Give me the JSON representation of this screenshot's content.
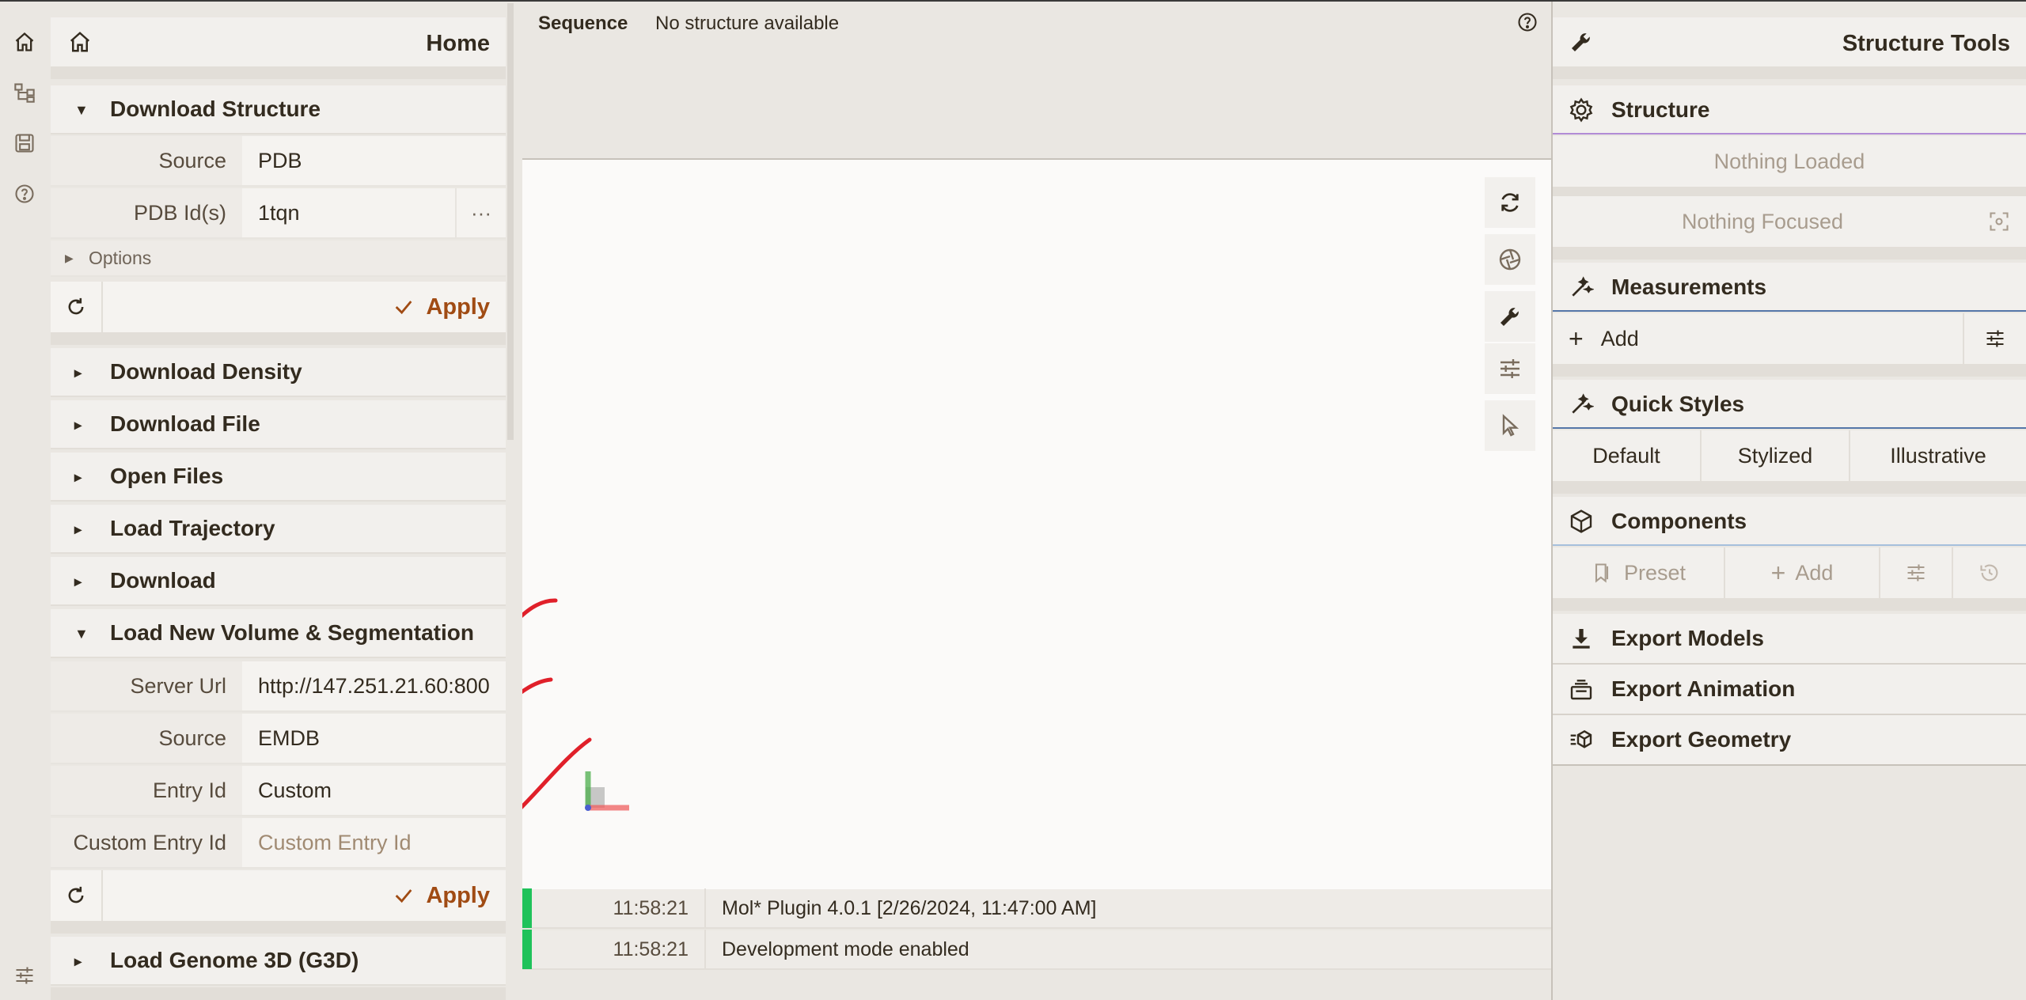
{
  "left_strip": {
    "icons": [
      "home-icon",
      "tree-icon",
      "save-icon",
      "help-icon",
      "settings-sliders-icon"
    ]
  },
  "left_panel": {
    "title": "Home",
    "download_structure": {
      "label": "Download Structure",
      "source_label": "Source",
      "source_value": "PDB",
      "pdb_label": "PDB Id(s)",
      "pdb_value": "1tqn",
      "more": "···",
      "options_label": "Options",
      "apply_label": "Apply"
    },
    "sections": [
      {
        "label": "Download Density"
      },
      {
        "label": "Download File"
      },
      {
        "label": "Open Files"
      },
      {
        "label": "Load Trajectory"
      },
      {
        "label": "Download"
      }
    ],
    "volume_seg": {
      "label": "Load New Volume & Segmentation",
      "server_label": "Server Url",
      "server_value": "http://147.251.21.60:800",
      "source_label": "Source",
      "source_value": "EMDB",
      "entry_label": "Entry Id",
      "entry_value": "Custom",
      "custom_label": "Custom Entry Id",
      "custom_placeholder": "Custom Entry Id",
      "apply_label": "Apply"
    },
    "genome": {
      "label": "Load Genome 3D (G3D)"
    }
  },
  "sequence": {
    "label": "Sequence",
    "status": "No structure available"
  },
  "log": [
    {
      "time": "11:58:21",
      "message": "Mol* Plugin 4.0.1 [2/26/2024, 11:47:00 AM]"
    },
    {
      "time": "11:58:21",
      "message": "Development mode enabled"
    }
  ],
  "right_panel": {
    "title": "Structure Tools",
    "structure": {
      "label": "Structure",
      "nothing_loaded": "Nothing Loaded",
      "nothing_focused": "Nothing Focused"
    },
    "measurements": {
      "label": "Measurements",
      "add_label": "Add"
    },
    "quick_styles": {
      "label": "Quick Styles",
      "options": [
        "Default",
        "Stylized",
        "Illustrative"
      ]
    },
    "components": {
      "label": "Components",
      "preset_label": "Preset",
      "add_label": "Add"
    },
    "export_models": {
      "label": "Export Models"
    },
    "export_animation": {
      "label": "Export Animation"
    },
    "export_geometry": {
      "label": "Export Geometry"
    }
  },
  "colors": {
    "accent": "#a04b13",
    "panel_bg": "#eae7e2",
    "canvas_bg": "#fbfaf9",
    "log_ok": "#1fc25a",
    "annotation_red": "#e0202a"
  }
}
